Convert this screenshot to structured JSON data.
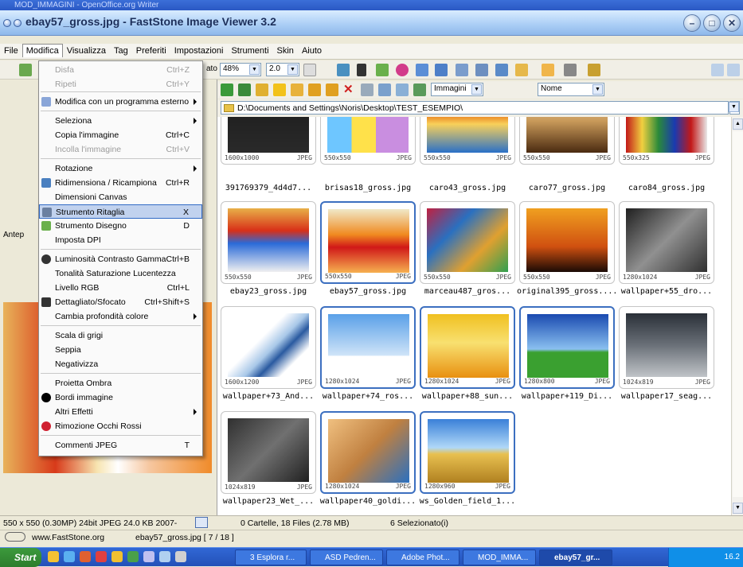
{
  "outer_title": "MOD_IMMAGINI - OpenOffice.org Writer",
  "window_title": "ebay57_gross.jpg  -  FastStone Image Viewer 3.2",
  "menubar": [
    "File",
    "Modifica",
    "Visualizza",
    "Tag",
    "Preferiti",
    "Impostazioni",
    "Strumenti",
    "Skin",
    "Aiuto"
  ],
  "toolbar": {
    "adatto_fragment": "ato",
    "zoom": "48%",
    "scale": "2.0"
  },
  "toolbar2": {
    "filter": "Immagini",
    "sort": "Nome"
  },
  "address": "D:\\Documents and Settings\\Noris\\Desktop\\TEST_ESEMPIO\\",
  "left_panel": {
    "tab_label": "Antep"
  },
  "menu": {
    "items": [
      {
        "label": "Disfa",
        "shortcut": "Ctrl+Z",
        "disabled": true
      },
      {
        "label": "Ripeti",
        "shortcut": "Ctrl+Y",
        "disabled": true
      },
      {
        "label": "Modifica con un programma esterno",
        "submenu": true
      },
      {
        "label": "Seleziona",
        "submenu": true
      },
      {
        "label": "Copia l'immagine",
        "shortcut": "Ctrl+C"
      },
      {
        "label": "Incolla l'immagine",
        "shortcut": "Ctrl+V",
        "disabled": true
      },
      {
        "label": "Rotazione",
        "submenu": true
      },
      {
        "label": "Ridimensiona / Ricampiona",
        "shortcut": "Ctrl+R"
      },
      {
        "label": "Dimensioni Canvas"
      },
      {
        "label": "Strumento Ritaglia",
        "shortcut": "X"
      },
      {
        "label": "Strumento Disegno",
        "shortcut": "D"
      },
      {
        "label": "Imposta DPI"
      },
      {
        "label": "Luminosità Contrasto Gamma",
        "shortcut": "Ctrl+B"
      },
      {
        "label": "Tonalità Saturazione Lucentezza"
      },
      {
        "label": "Livello RGB",
        "shortcut": "Ctrl+L"
      },
      {
        "label": "Dettagliato/Sfocato",
        "shortcut": "Ctrl+Shift+S"
      },
      {
        "label": "Cambia profondità colore",
        "submenu": true
      },
      {
        "label": "Scala di grigi"
      },
      {
        "label": "Seppia"
      },
      {
        "label": "Negativizza"
      },
      {
        "label": "Proietta Ombra"
      },
      {
        "label": "Bordi immagine"
      },
      {
        "label": "Altri Effetti",
        "submenu": true
      },
      {
        "label": "Rimozione Occhi Rossi"
      },
      {
        "label": "Commenti JPEG",
        "shortcut": "T"
      }
    ]
  },
  "thumbnails": [
    {
      "name": "391769379_4d4d7...",
      "dims": "1600x1000",
      "fmt": "JPEG"
    },
    {
      "name": "brisas18_gross.jpg",
      "dims": "550x550",
      "fmt": "JPEG"
    },
    {
      "name": "caro43_gross.jpg",
      "dims": "550x550",
      "fmt": "JPEG"
    },
    {
      "name": "caro77_gross.jpg",
      "dims": "550x550",
      "fmt": "JPEG"
    },
    {
      "name": "caro84_gross.jpg",
      "dims": "550x325",
      "fmt": "JPEG"
    },
    {
      "name": "ebay23_gross.jpg",
      "dims": "550x550",
      "fmt": "JPEG"
    },
    {
      "name": "ebay57_gross.jpg",
      "dims": "550x550",
      "fmt": "JPEG"
    },
    {
      "name": "marceau487_gros...",
      "dims": "550x550",
      "fmt": "JPEG"
    },
    {
      "name": "original395_gross....",
      "dims": "550x550",
      "fmt": "JPEG"
    },
    {
      "name": "wallpaper+55_dro...",
      "dims": "1280x1024",
      "fmt": "JPEG"
    },
    {
      "name": "wallpaper+73_And...",
      "dims": "1600x1200",
      "fmt": "JPEG"
    },
    {
      "name": "wallpaper+74_ros...",
      "dims": "1280x1024",
      "fmt": "JPEG"
    },
    {
      "name": "wallpaper+88_sun...",
      "dims": "1280x1024",
      "fmt": "JPEG"
    },
    {
      "name": "wallpaper+119_Di...",
      "dims": "1280x800",
      "fmt": "JPEG"
    },
    {
      "name": "wallpaper17_seag...",
      "dims": "1024x819",
      "fmt": "JPEG"
    },
    {
      "name": "wallpaper23_Wet_...",
      "dims": "1024x819",
      "fmt": "JPEG"
    },
    {
      "name": "wallpaper40_goldi...",
      "dims": "1280x1024",
      "fmt": "JPEG"
    },
    {
      "name": "ws_Golden_field_1...",
      "dims": "1280x960",
      "fmt": "JPEG"
    }
  ],
  "status": {
    "info": "550 x 550 (0.30MP)  24bit JPEG  24.0 KB  2007-",
    "folders": "0 Cartelle, 18 Files (2.78 MB)",
    "selected": "6 Selezionato(i)"
  },
  "bottom": {
    "site": "www.FastStone.org",
    "file": "ebay57_gross.jpg [ 7 / 18 ]"
  },
  "taskbar": {
    "start": "Start",
    "tasks": [
      "3 Esplora r...",
      "ASD Pedren...",
      "Adobe Phot...",
      "MOD_IMMA...",
      "ebay57_gr..."
    ],
    "clock": "16.2"
  }
}
